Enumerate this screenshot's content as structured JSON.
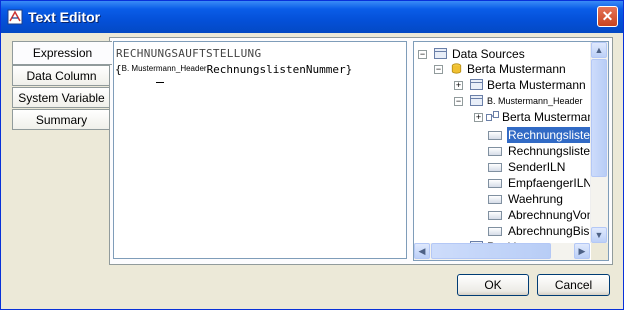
{
  "window": {
    "title": "Text Editor"
  },
  "tabs": [
    {
      "label": "Expression"
    },
    {
      "label": "Data Column"
    },
    {
      "label": "System Variable"
    },
    {
      "label": "Summary"
    }
  ],
  "editor": {
    "line1": "RECHNUNGSAUFTSTELLUNG",
    "line2_open": "{",
    "line2_small": "B. Mustermann_Header",
    "line2_main": "RechnungslistenNummer}"
  },
  "tree": {
    "items": [
      {
        "label": "Data Sources"
      },
      {
        "label": "Berta Mustermann"
      },
      {
        "label": "Berta Mustermann"
      },
      {
        "label": "B. Mustermann_Header"
      },
      {
        "label": "Berta Mustermann"
      },
      {
        "label": "RechnungslistenN"
      },
      {
        "label": "RechnungslistenD"
      },
      {
        "label": "SenderILN"
      },
      {
        "label": "EmpfaengerILN"
      },
      {
        "label": "Waehrung"
      },
      {
        "label": "AbrechnungVonD"
      },
      {
        "label": "AbrechnungBisD"
      },
      {
        "label": "Positions"
      }
    ]
  },
  "buttons": {
    "ok": "OK",
    "cancel": "Cancel"
  },
  "colors": {
    "titlebar": "#0450d8",
    "selection": "#316ac5",
    "dialog_bg": "#ece9d8"
  }
}
